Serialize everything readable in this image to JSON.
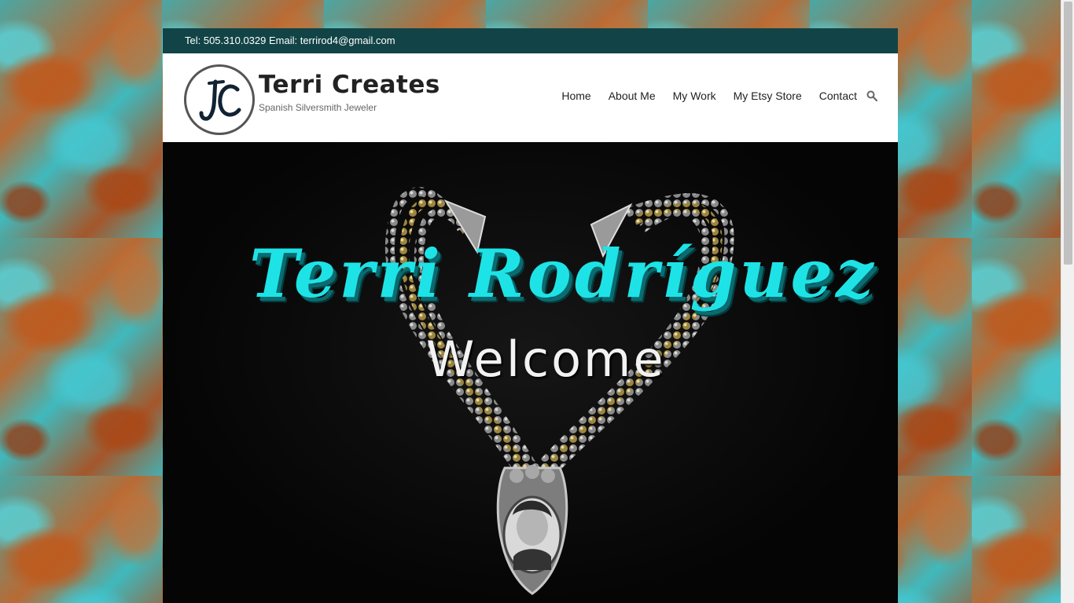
{
  "topbar": {
    "contact": "Tel: 505.310.0329 Email: terrirod4@gmail.com"
  },
  "header": {
    "logo_monogram": "JC",
    "site_title": "Terri Creates",
    "site_description": "Spanish Silversmith Jeweler"
  },
  "nav": {
    "items": [
      {
        "label": "Home"
      },
      {
        "label": "About Me"
      },
      {
        "label": "My Work"
      },
      {
        "label": "My Etsy Store"
      },
      {
        "label": "Contact"
      }
    ],
    "search_icon": "search-icon"
  },
  "hero": {
    "title": "Terri Rodríguez",
    "subtitle": "Welcome"
  },
  "colors": {
    "topbar_bg": "#124447",
    "accent_turquoise": "#1ee3e6",
    "hero_bg": "#000000"
  }
}
